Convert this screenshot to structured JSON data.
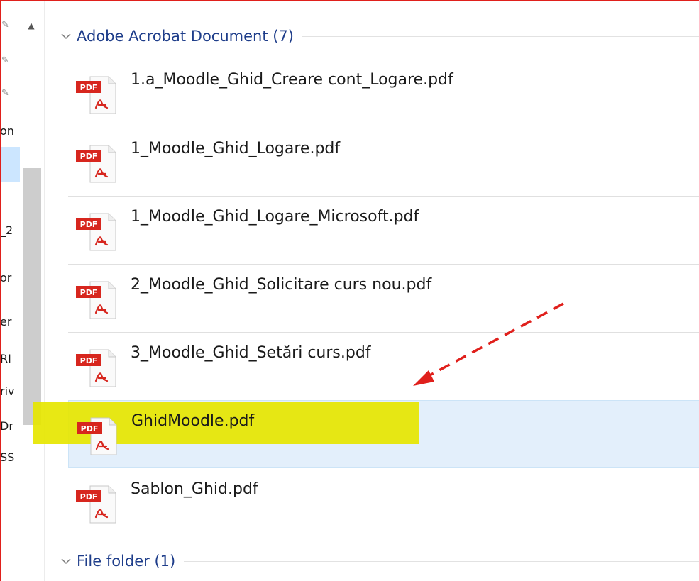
{
  "navpane": {
    "items": [
      "on",
      "_2",
      "or",
      "er",
      "RI",
      "riv",
      "Dr",
      "SS"
    ]
  },
  "groups": [
    {
      "label": "Adobe Acrobat Document (7)",
      "expanded": true
    },
    {
      "label": "File folder (1)",
      "expanded": true
    }
  ],
  "files": [
    {
      "name": "1.a_Moodle_Ghid_Creare cont_Logare.pdf",
      "icon": "pdf-icon"
    },
    {
      "name": "1_Moodle_Ghid_Logare.pdf",
      "icon": "pdf-icon"
    },
    {
      "name": "1_Moodle_Ghid_Logare_Microsoft.pdf",
      "icon": "pdf-icon"
    },
    {
      "name": "2_Moodle_Ghid_Solicitare curs nou.pdf",
      "icon": "pdf-icon"
    },
    {
      "name": "3_Moodle_Ghid_Setări curs.pdf",
      "icon": "pdf-icon"
    },
    {
      "name": "GhidMoodle.pdf",
      "icon": "pdf-icon",
      "selected": true,
      "highlighted": true
    },
    {
      "name": "Sablon_Ghid.pdf",
      "icon": "pdf-icon"
    }
  ],
  "pdf_badge": "PDF",
  "colors": {
    "group_label": "#1e3d8a",
    "selection": "#e3effb",
    "highlight": "#e6e600",
    "annotation": "#e0201c"
  }
}
